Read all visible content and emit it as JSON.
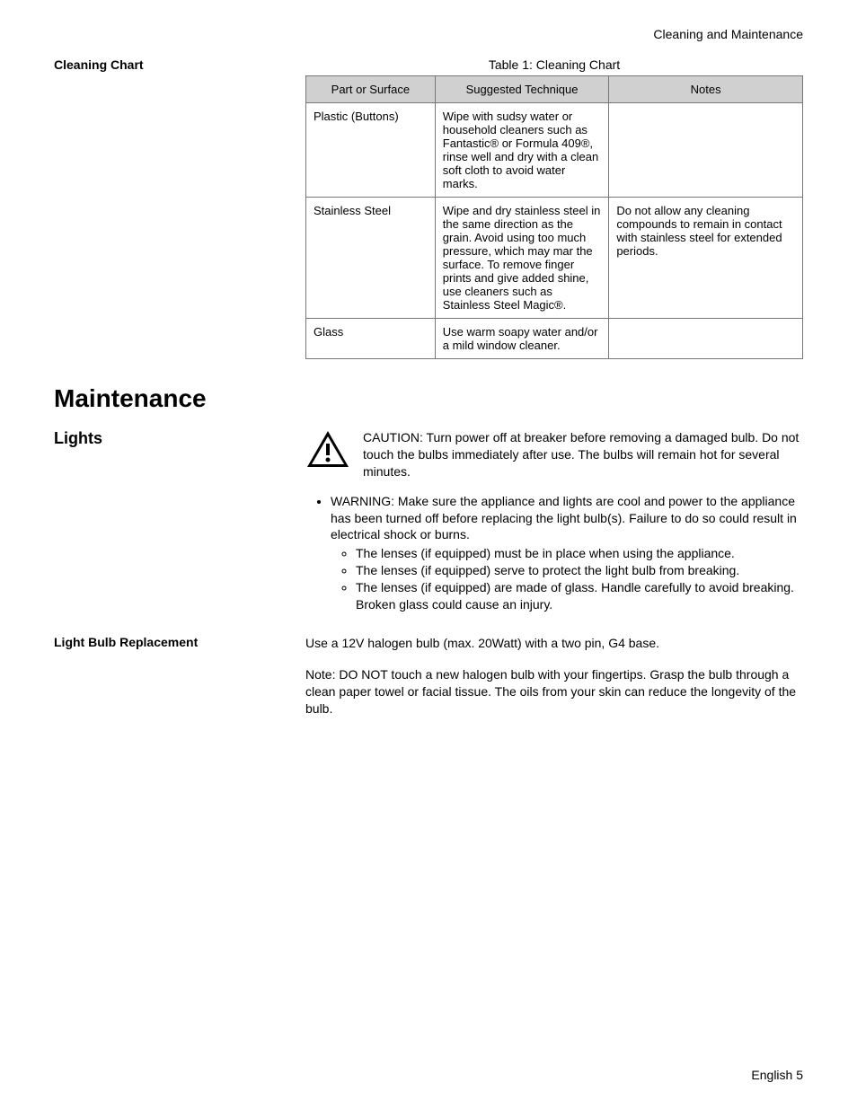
{
  "header": {
    "breadcrumb": "Cleaning and Maintenance"
  },
  "cleaning": {
    "side_heading": "Cleaning Chart",
    "caption": "Table 1: Cleaning Chart",
    "headers": {
      "part": "Part or Surface",
      "technique": "Suggested Technique",
      "notes": "Notes"
    },
    "rows": [
      {
        "part": "Plastic (Buttons)",
        "technique": "Wipe with sudsy water or household cleaners such as Fantastic® or Formula 409®, rinse well and dry with a clean soft cloth to avoid water marks.",
        "notes": ""
      },
      {
        "part": "Stainless Steel",
        "technique": "Wipe and dry stainless steel in the same direc­tion as the grain. Avoid using too much pres­sure, which may mar the surface. To remove fin­ger prints and give added shine, use clean­ers such as Stainless Steel Magic®.",
        "notes": "Do not allow any cleaning compounds to remain in contact with stainless steel for extended periods."
      },
      {
        "part": "Glass",
        "technique": "Use warm soapy water and/or a mild window cleaner.",
        "notes": ""
      }
    ]
  },
  "maintenance": {
    "heading": "Maintenance",
    "lights": {
      "side_heading": "Lights",
      "caution": "CAUTION: Turn power off at breaker before removing a damaged bulb. Do not touch the bulbs immediately after use. The bulbs will remain hot for several minutes.",
      "warning": "WARNING: Make sure the appliance and lights are cool and power to the appliance has been turned off before replacing the light bulb(s). Failure to do so could result in electrical shock or burns.",
      "sub": [
        "The lenses (if equipped) must be in place when using the appliance.",
        "The lenses (if equipped) serve to protect the light bulb from breaking.",
        "The lenses (if equipped) are made of glass. Handle carefully to avoid breaking. Broken glass could cause an injury."
      ]
    },
    "replacement": {
      "side_heading": "Light Bulb Replacement",
      "p1": "Use a 12V halogen bulb (max. 20Watt) with a two pin, G4 base.",
      "p2": "Note: DO NOT touch a new halogen bulb with your fingertips. Grasp the bulb through a clean paper towel or facial tissue. The oils from your skin can reduce the longevity of the bulb."
    }
  },
  "footer": "English 5",
  "chart_data": {
    "type": "table",
    "title": "Table 1: Cleaning Chart",
    "columns": [
      "Part or Surface",
      "Suggested Technique",
      "Notes"
    ],
    "rows": [
      [
        "Plastic (Buttons)",
        "Wipe with sudsy water or household cleaners such as Fantastic® or Formula 409®, rinse well and dry with a clean soft cloth to avoid water marks.",
        ""
      ],
      [
        "Stainless Steel",
        "Wipe and dry stainless steel in the same direction as the grain. Avoid using too much pressure, which may mar the surface. To remove finger prints and give added shine, use cleaners such as Stainless Steel Magic®.",
        "Do not allow any cleaning compounds to remain in contact with stainless steel for extended periods."
      ],
      [
        "Glass",
        "Use warm soapy water and/or a mild window cleaner.",
        ""
      ]
    ]
  }
}
